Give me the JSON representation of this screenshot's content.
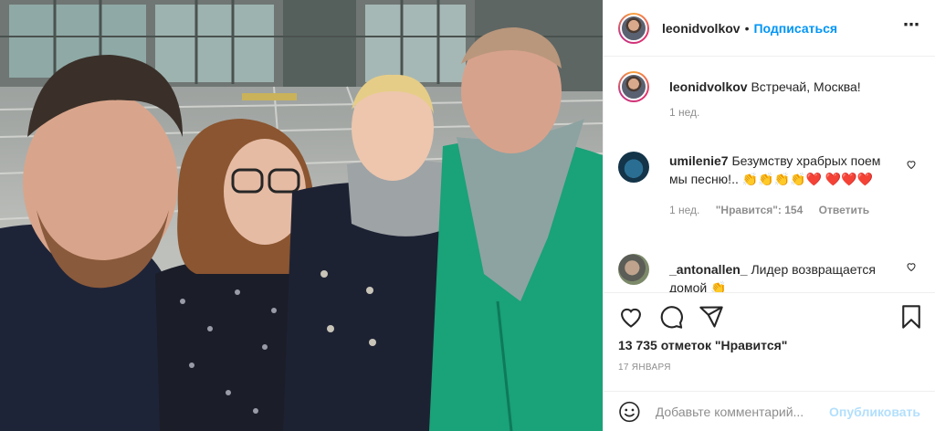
{
  "post": {
    "author": "leonidvolkov",
    "follow_label": "Подписаться",
    "dot": "•",
    "more_icon": "ellipsis-icon"
  },
  "caption": {
    "username": "leonidvolkov",
    "text": "Встречай, Москва!",
    "time": "1 нед."
  },
  "comments": [
    {
      "username": "umilenie7",
      "text": "Безумству храбрых поем мы песню!..",
      "emoji": "👏👏👏👏❤️ ❤️❤️❤️",
      "time": "1 нед.",
      "likes": "\"Нравится\": 154",
      "reply": "Ответить"
    },
    {
      "username": "_antonallen_",
      "text": "Лидер возвращается домой 👏"
    }
  ],
  "stats": {
    "likes": "13 735 отметок \"Нравится\"",
    "date": "17 января"
  },
  "composer": {
    "placeholder": "Добавьте комментарий...",
    "publish": "Опубликовать"
  },
  "colors": {
    "accent": "#0095f6",
    "publish_disabled": "#b2dffc",
    "muted": "#8e8e8e"
  }
}
